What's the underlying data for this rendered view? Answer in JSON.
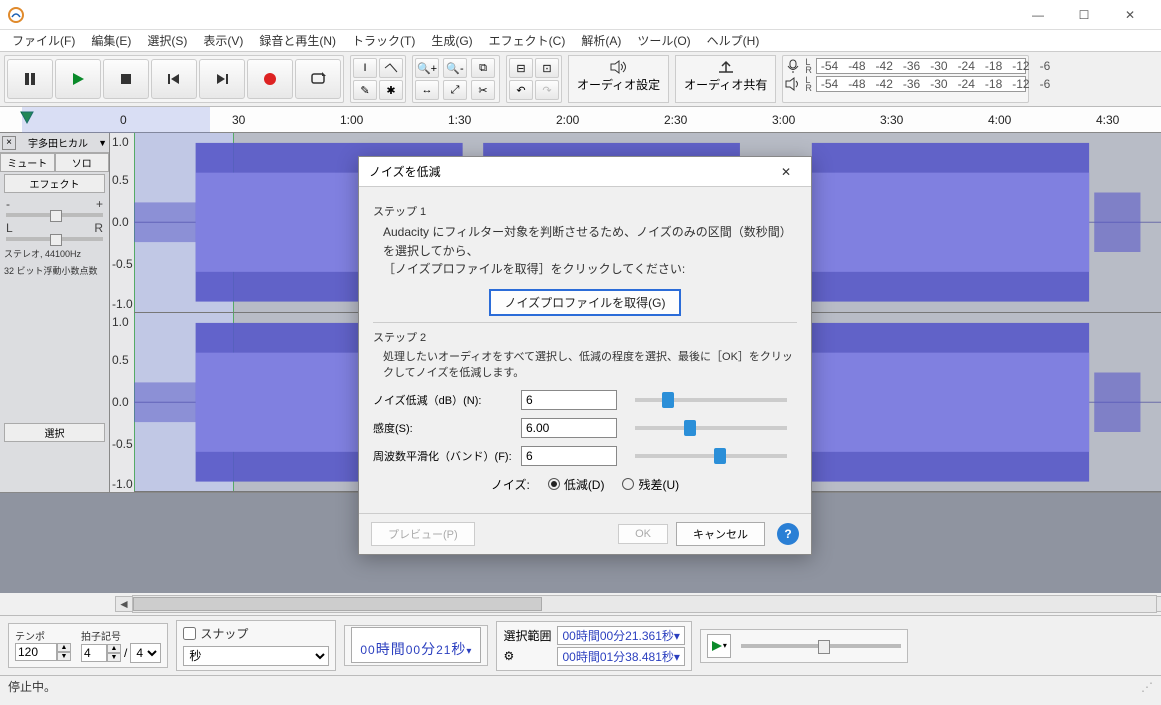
{
  "titlebar": {
    "app": ""
  },
  "menu": [
    "ファイル(F)",
    "編集(E)",
    "選択(S)",
    "表示(V)",
    "録音と再生(N)",
    "トラック(T)",
    "生成(G)",
    "エフェクト(C)",
    "解析(A)",
    "ツール(O)",
    "ヘルプ(H)"
  ],
  "toolbar": {
    "audio_settings": "オーディオ設定",
    "audio_share": "オーディオ共有",
    "meter_ticks": [
      "-54",
      "-48",
      "-42",
      "-36",
      "-30",
      "-24",
      "-18",
      "-12",
      "-6"
    ]
  },
  "ruler": {
    "labels": [
      "0",
      "30",
      "1:00",
      "1:30",
      "2:00",
      "2:30",
      "3:00",
      "3:30",
      "4:00",
      "4:30"
    ]
  },
  "track": {
    "name": "宇多田ヒカル",
    "mute": "ミュート",
    "solo": "ソロ",
    "effect": "エフェクト",
    "pan_l": "L",
    "pan_r": "R",
    "info1": "ステレオ, 44100Hz",
    "info2": "32 ビット浮動小数点数",
    "select": "選択",
    "scale": [
      "1.0",
      "0.5",
      "0.0",
      "-0.5",
      "-1.0"
    ]
  },
  "bottom": {
    "tempo_label": "テンポ",
    "tempo": "120",
    "timesig_label": "拍子記号",
    "timesig_n": "4",
    "timesig_d": "4",
    "snap_label": "スナップ",
    "snap_unit": "秒",
    "big_time_h": "00",
    "big_time_hu": "時間",
    "big_time_m": "00",
    "big_time_mu": "分",
    "big_time_s": "21",
    "big_time_su": "秒",
    "sel_label": "選択範囲",
    "sel_start": "00時間00分21.361秒",
    "sel_end": "00時間01分38.481秒",
    "gear": "⚙"
  },
  "status": {
    "text": "停止中。"
  },
  "dialog": {
    "title": "ノイズを低減",
    "step1": "ステップ 1",
    "step1_text1": "Audacity にフィルター対象を判断させるため、ノイズのみの区間（数秒間）を選択してから、",
    "step1_text2": "［ノイズプロファイルを取得］をクリックしてください:",
    "get_profile": "ノイズプロファイルを取得(G)",
    "step2": "ステップ 2",
    "step2_text": "処理したいオーディオをすべて選択し、低減の程度を選択、最後に［OK］をクリックしてノイズを低減します。",
    "p1_label": "ノイズ低減（dB）(N):",
    "p1_val": "6",
    "p2_label": "感度(S):",
    "p2_val": "6.00",
    "p3_label": "周波数平滑化（バンド）(F):",
    "p3_val": "6",
    "noise_label": "ノイズ:",
    "radio_reduce": "低減(D)",
    "radio_resid": "残差(U)",
    "preview": "プレビュー(P)",
    "ok": "OK",
    "cancel": "キャンセル"
  }
}
